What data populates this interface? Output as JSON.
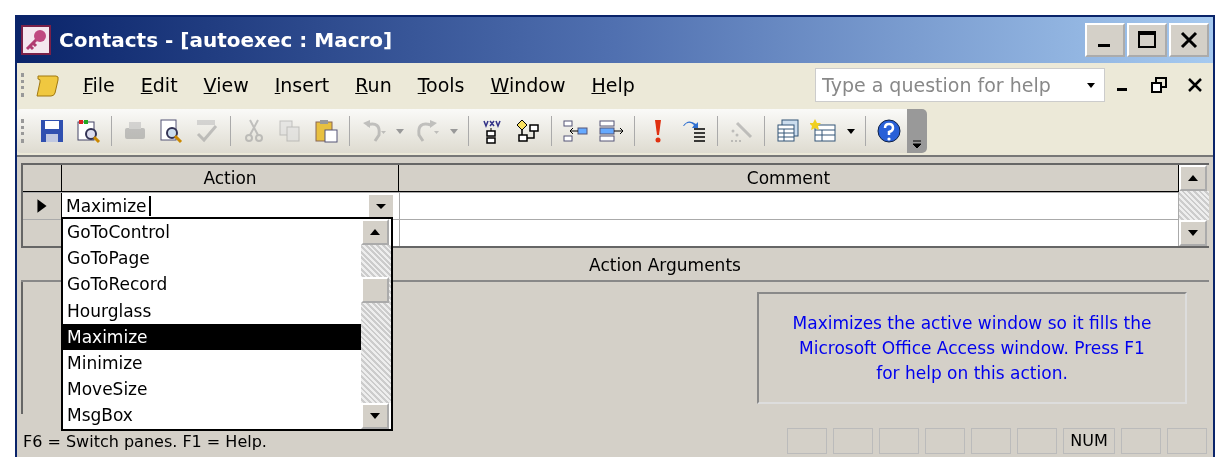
{
  "window": {
    "title": "Contacts - [autoexec : Macro]"
  },
  "menu": [
    "File",
    "Edit",
    "View",
    "Insert",
    "Run",
    "Tools",
    "Window",
    "Help"
  ],
  "help_box": {
    "placeholder": "Type a question for help"
  },
  "toolbar": [
    {
      "disabled": false
    },
    {
      "disabled": false
    },
    {
      "disabled": true
    },
    {
      "disabled": false
    },
    {
      "disabled": true
    },
    {
      "disabled": true
    },
    {
      "disabled": true
    },
    {
      "disabled": false
    },
    {
      "disabled": true
    },
    {
      "disabled": true
    },
    {
      "disabled": false
    },
    {
      "disabled": false
    },
    {
      "disabled": false
    },
    {
      "disabled": false
    },
    {
      "disabled": false
    },
    {
      "disabled": false
    },
    {
      "disabled": true
    },
    {
      "disabled": false
    },
    {
      "disabled": false
    },
    {
      "disabled": false
    }
  ],
  "grid": {
    "columns": [
      "Action",
      "Comment"
    ],
    "rows": [
      {
        "current": true,
        "action": "Maximize"
      },
      {
        "current": false,
        "action": ""
      }
    ]
  },
  "dropdown": {
    "items": [
      {
        "label": "GoToControl",
        "selected": false
      },
      {
        "label": "GoToPage",
        "selected": false
      },
      {
        "label": "GoToRecord",
        "selected": false
      },
      {
        "label": "Hourglass",
        "selected": false
      },
      {
        "label": "Maximize",
        "selected": true
      },
      {
        "label": "Minimize",
        "selected": false
      },
      {
        "label": "MoveSize",
        "selected": false
      },
      {
        "label": "MsgBox",
        "selected": false
      }
    ]
  },
  "arguments": {
    "title": "Action Arguments",
    "help_text": "Maximizes the active window so it fills the Microsoft Office Access window. Press F1 for help on this action."
  },
  "status_bar": {
    "text": "F6 = Switch panes.  F1 = Help.",
    "panels": [
      "NUM"
    ]
  }
}
